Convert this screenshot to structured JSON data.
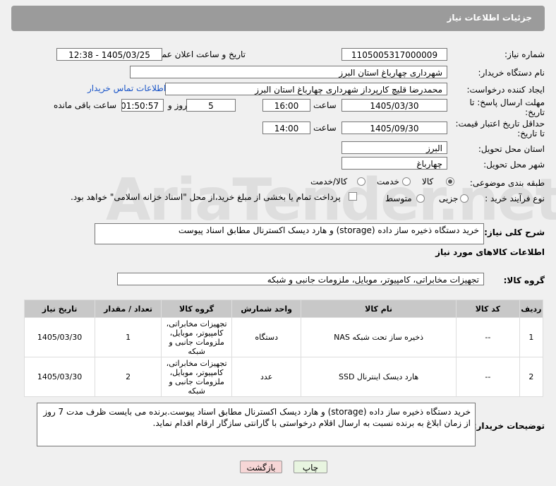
{
  "header": {
    "title": "جزئیات اطلاعات نیاز"
  },
  "fields": {
    "need_number_label": "شماره نیاز:",
    "need_number": "1105005317000009",
    "announce_label": "تاریخ و ساعت اعلان عمومی:",
    "announce_value": "1405/03/25 - 12:38",
    "buyer_org_label": "نام دستگاه خریدار:",
    "buyer_org": "شهرداری چهارباغ استان البرز",
    "requester_label": "ایجاد کننده درخواست:",
    "requester": "محمدرضا قلیچ کارپرداز شهرداری چهارباغ استان البرز",
    "contact_link": "اطلاعات تماس خریدار",
    "deadline_label_1": "مهلت ارسال پاسخ: تا",
    "deadline_label_2": "تاریخ:",
    "deadline_date": "1405/03/30",
    "time_label": "ساعت",
    "deadline_time": "16:00",
    "days_value": "5",
    "days_label": "روز و",
    "remaining_time": "01:50:57",
    "remaining_label": "ساعت باقی مانده",
    "validity_label_1": "حداقل تاریخ اعتبار قیمت:",
    "validity_label_2": "تا تاریخ:",
    "validity_date": "1405/09/30",
    "validity_time": "14:00",
    "province_label": "استان محل تحویل:",
    "province": "البرز",
    "city_label": "شهر محل تحویل:",
    "city": "چهارباغ",
    "category_label": "طبقه بندی موضوعی:",
    "category_options": [
      "کالا",
      "خدمت",
      "کالا/خدمت"
    ],
    "process_label": "نوع فرآیند خرید :",
    "process_options": [
      "جزیی",
      "متوسط"
    ],
    "payment_text": "پرداخت تمام یا بخشی از مبلغ خرید،از محل \"اسناد خزانه اسلامی\" خواهد بود."
  },
  "summary": {
    "label": "شرح کلی نیاز:",
    "value": "خرید دستگاه ذخیره ساز داده (storage) و هارد دیسک اکسترنال مطابق اسناد پیوست"
  },
  "goods_info_title": "اطلاعات کالاهای مورد نیاز",
  "goods_group": {
    "label": "گروه کالا:",
    "value": "تجهیزات مخابراتی، کامپیوتر، موبایل، ملزومات جانبی و شبکه"
  },
  "table": {
    "headers": [
      "ردیف",
      "کد کالا",
      "نام کالا",
      "واحد شمارش",
      "گروه کالا",
      "تعداد / مقدار",
      "تاریخ نیاز"
    ],
    "rows": [
      {
        "row": "1",
        "code": "--",
        "name": "ذخیره ساز تحت شبکه NAS",
        "unit": "دستگاه",
        "group": "تجهیزات مخابراتی، کامپیوتر، موبایل، ملزومات جانبی و شبکه",
        "qty": "1",
        "date": "1405/03/30"
      },
      {
        "row": "2",
        "code": "--",
        "name": "هارد دیسک اینترنال SSD",
        "unit": "عدد",
        "group": "تجهیزات مخابراتی، کامپیوتر، موبایل، ملزومات جانبی و شبکه",
        "qty": "2",
        "date": "1405/03/30"
      }
    ]
  },
  "buyer_notes": {
    "label": "توضیحات خریدار:",
    "value": "خرید دستگاه ذخیره ساز داده (storage) و هارد دیسک اکسترنال مطابق اسناد پیوست.برنده می بایست ظرف مدت 7 روز از زمان ابلاغ به برنده نسبت به ارسال اقلام درخواستی با گارانتی سازگار ارقام اقدام نماید."
  },
  "buttons": {
    "print": "چاپ",
    "back": "بازگشت"
  },
  "colors": {
    "header_bg": "#9b9b9b",
    "link": "#1a55c8",
    "back_button_bg": "#f6d6d6",
    "print_button_bg": "#e8f5e0"
  }
}
